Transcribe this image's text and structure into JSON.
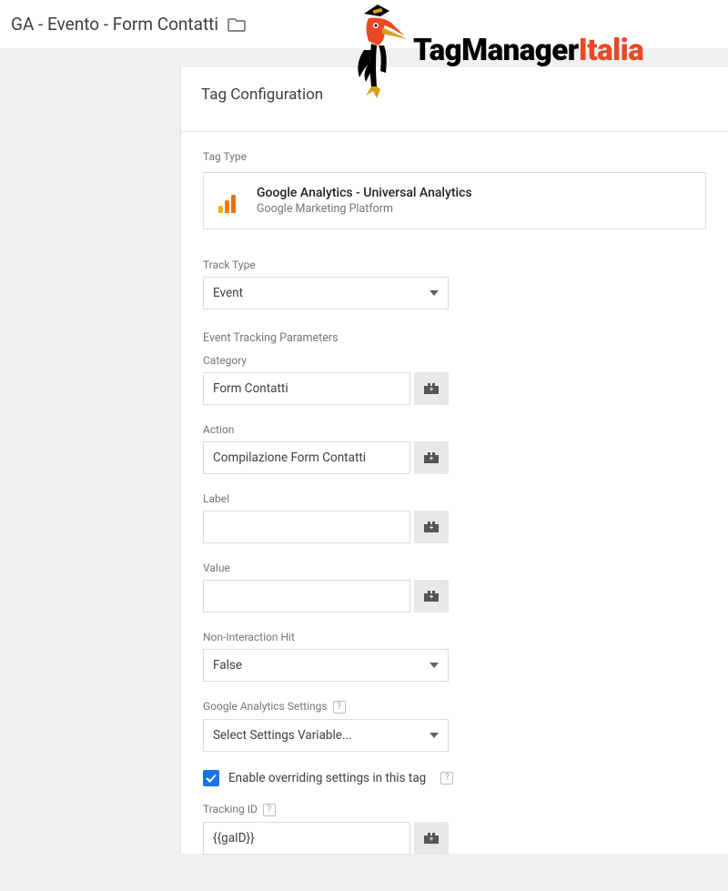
{
  "header": {
    "tag_name": "GA - Evento - Form Contatti"
  },
  "logo": {
    "text_black": "TagManager",
    "text_red": "Italia"
  },
  "section_title": "Tag Configuration",
  "tag_type": {
    "label": "Tag Type",
    "name": "Google Analytics - Universal Analytics",
    "platform": "Google Marketing Platform"
  },
  "track_type": {
    "label": "Track Type",
    "value": "Event"
  },
  "event_params_title": "Event Tracking Parameters",
  "category": {
    "label": "Category",
    "value": "Form Contatti"
  },
  "action": {
    "label": "Action",
    "value": "Compilazione Form Contatti"
  },
  "label_field": {
    "label": "Label",
    "value": ""
  },
  "value_field": {
    "label": "Value",
    "value": ""
  },
  "non_interaction": {
    "label": "Non-Interaction Hit",
    "value": "False"
  },
  "ga_settings": {
    "label": "Google Analytics Settings",
    "value": "Select Settings Variable..."
  },
  "override": {
    "checked": true,
    "label": "Enable overriding settings in this tag"
  },
  "tracking_id": {
    "label": "Tracking ID",
    "value": "{{gaID}}"
  }
}
